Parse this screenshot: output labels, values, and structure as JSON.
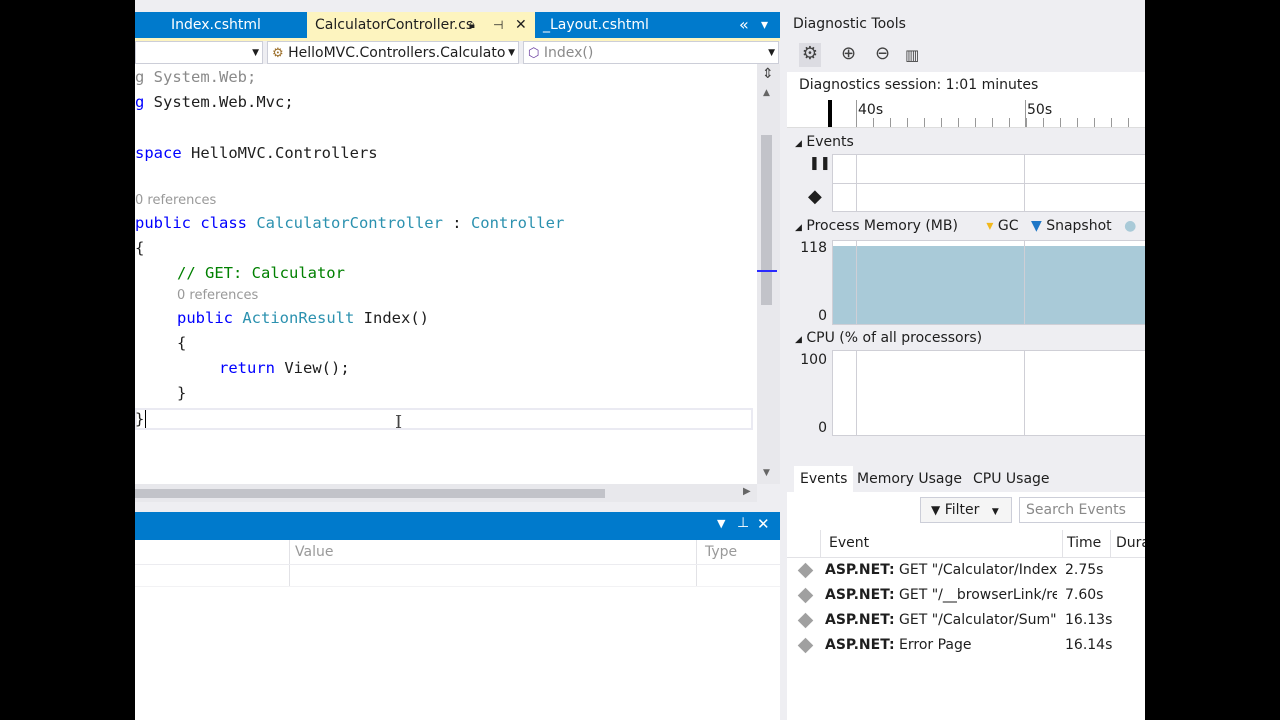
{
  "editor": {
    "tabs": [
      {
        "label": "Index.cshtml"
      },
      {
        "label": "CalculatorController.cs"
      },
      {
        "label": "_Layout.cshtml"
      }
    ],
    "tab_pin_glyph": "⊣",
    "tab_close_glyph": "✕",
    "tab_overflow_glyph": "«",
    "tab_dropdown_glyph": "▾",
    "nav": {
      "class_combo": "HelloMVC.Controllers.Calculato",
      "member_combo": "Index()"
    },
    "code": {
      "line1_kw": "g",
      "line1_rest": " System.Web;",
      "line2_kw": "g",
      "line2_rest": " System.Web.Mvc;",
      "line3_kw": "space",
      "line3_rest": " HelloMVC.Controllers",
      "lens1": "0 references",
      "line4_kw": "public class",
      "line4_type": "CalculatorController",
      "line4_colon": " : ",
      "line4_base": "Controller",
      "line5": "{",
      "line6_comment": "// GET: Calculator",
      "lens2": "0 references",
      "line7_kw": "public",
      "line7_type": "ActionResult",
      "line7_rest": " Index()",
      "line8": "{",
      "line9_kw": "return",
      "line9_rest": " View();",
      "line10": "}",
      "line11": "}"
    }
  },
  "bottom_panel": {
    "col_value": "Value",
    "col_type": "Type"
  },
  "diagnostics": {
    "title": "Diagnostic Tools",
    "session": "Diagnostics session: 1:01 minutes",
    "ruler_labels": [
      "40s",
      "50s"
    ],
    "events_section": "Events",
    "memory_section": "Process Memory (MB)",
    "memory_legend_gc": "GC",
    "memory_legend_snapshot": "Snapshot",
    "memory_ymax": "118",
    "memory_ymin": "0",
    "cpu_section": "CPU (% of all processors)",
    "cpu_ymax": "100",
    "cpu_ymin": "0",
    "tabs": [
      "Events",
      "Memory Usage",
      "CPU Usage"
    ],
    "filter_label": "Filter",
    "search_placeholder": "Search Events",
    "table_headers": [
      "Event",
      "Time",
      "Dura"
    ],
    "events": [
      {
        "source": "ASP.NET:",
        "desc": " GET \"/Calculator/Index\"",
        "time": "2.75s"
      },
      {
        "source": "ASP.NET:",
        "desc": " GET \"/__browserLink/re...",
        "time": "7.60s"
      },
      {
        "source": "ASP.NET:",
        "desc": " GET \"/Calculator/Sum\"",
        "time": "16.13s"
      },
      {
        "source": "ASP.NET:",
        "desc": " Error Page",
        "time": "16.14s"
      }
    ]
  },
  "colors": {
    "accent": "#007acc",
    "active_tab": "#fdf4bf",
    "memory_fill": "#a9cad8"
  }
}
